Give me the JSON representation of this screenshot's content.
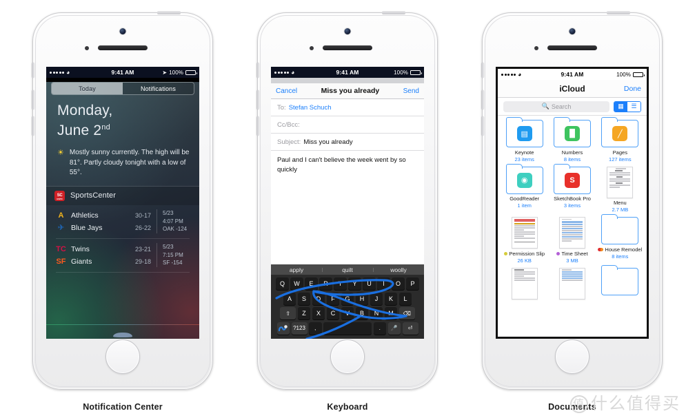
{
  "statusbar": {
    "time": "9:41 AM",
    "battery": "100%",
    "carrier_dots": 5,
    "wifi_icon": "wifi-icon",
    "location_icon": "location-arrow-icon"
  },
  "panel1": {
    "caption": "Notification Center",
    "segmented": {
      "today": "Today",
      "notifications": "Notifications",
      "selected": "Today"
    },
    "date_line1": "Monday,",
    "date_line2": "June 2",
    "date_ordinal": "nd",
    "weather_icon": "sun-icon",
    "weather_text": "Mostly sunny currently. The high will be 81°. Partly cloudy tonight with a low of 55°.",
    "widget_title": "SportsCenter",
    "widget_logo": "espn-sportscenter-icon",
    "games": [
      {
        "rows": [
          {
            "logo": "athletics-icon",
            "logo_glyph": "A",
            "logo_color": "#efb21e",
            "team": "Athletics",
            "record": "30-17"
          },
          {
            "logo": "blue-jays-icon",
            "logo_glyph": "⚑",
            "logo_color": "#134a8e",
            "team": "Blue Jays",
            "record": "26-22"
          }
        ],
        "date": "5/23",
        "time": "4:07 PM",
        "line": "OAK -124"
      },
      {
        "rows": [
          {
            "logo": "twins-icon",
            "logo_glyph": "TC",
            "logo_color": "#d31145",
            "team": "Twins",
            "record": "23-21"
          },
          {
            "logo": "giants-icon",
            "logo_glyph": "SF",
            "logo_color": "#fd5a1e",
            "team": "Giants",
            "record": "29-18"
          }
        ],
        "date": "5/23",
        "time": "7:15 PM",
        "line": "SF -154"
      }
    ],
    "grabber": "grabber-handle"
  },
  "panel2": {
    "caption": "Keyboard",
    "nav": {
      "cancel": "Cancel",
      "title": "Miss you already",
      "send": "Send"
    },
    "fields": [
      {
        "label": "To:",
        "value": "Stefan Schuch",
        "style": "blue"
      },
      {
        "label": "Cc/Bcc:",
        "value": "",
        "style": "blue"
      },
      {
        "label": "Subject:",
        "value": "Miss you already",
        "style": "dark"
      }
    ],
    "body": "Paul and I can't believe the week went by so quickly",
    "keyboard": {
      "suggestions": [
        "apply",
        "quilt",
        "woolly"
      ],
      "row1": [
        "Q",
        "W",
        "E",
        "R",
        "T",
        "Y",
        "U",
        "I",
        "O",
        "P"
      ],
      "row2": [
        "A",
        "S",
        "D",
        "F",
        "G",
        "H",
        "J",
        "K",
        "L"
      ],
      "row3_shift": "shift-icon",
      "row3": [
        "Z",
        "X",
        "C",
        "V",
        "B",
        "N",
        "M"
      ],
      "row3_backspace": "backspace-icon",
      "bottom": {
        "swype": "swype-trace-icon",
        "numbers": "?123",
        "comma": ",",
        "space": "",
        "period": ".",
        "mic": "microphone-icon",
        "enter": "return-icon"
      },
      "trace": "blue-swipe-trace"
    }
  },
  "panel3": {
    "caption": "Documents",
    "nav": {
      "title": "iCloud",
      "done": "Done"
    },
    "search_placeholder": "Search",
    "search_icon": "search-icon",
    "view_grid_icon": "grid-view-icon",
    "view_list_icon": "list-view-icon",
    "view_selected": "grid",
    "items": [
      {
        "type": "folder",
        "app": "keynote-icon",
        "icon_glyph": "▤",
        "icon_bg": "#1f9bf0",
        "name": "Keynote",
        "sub": "23 items",
        "tag": ""
      },
      {
        "type": "folder",
        "app": "numbers-icon",
        "icon_glyph": "█",
        "icon_bg": "#3ec45f",
        "name": "Numbers",
        "sub": "8 items",
        "tag": ""
      },
      {
        "type": "folder",
        "app": "pages-icon",
        "icon_glyph": "✎",
        "icon_bg": "#f5a623",
        "name": "Pages",
        "sub": "127 items",
        "tag": ""
      },
      {
        "type": "folder",
        "app": "goodreader-icon",
        "icon_glyph": "◉",
        "icon_bg": "#3ecfc0",
        "name": "GoodReader",
        "sub": "1 item",
        "tag": ""
      },
      {
        "type": "folder",
        "app": "sketchbook-icon",
        "icon_glyph": "S",
        "icon_bg": "#e8302a",
        "name": "SketchBook Pro",
        "sub": "3 items",
        "tag": ""
      },
      {
        "type": "doc",
        "variant": "menu",
        "name": "Menu",
        "sub": "2.7 MB",
        "tag": ""
      },
      {
        "type": "doc",
        "variant": "permission",
        "name": "Permission Slip",
        "sub": "26 KB",
        "tag": "#d6cc3a"
      },
      {
        "type": "doc",
        "variant": "timesheet",
        "name": "Time Sheet",
        "sub": "3 MB",
        "tag": "#b35fd6"
      },
      {
        "type": "folder",
        "app": "plain-folder-icon",
        "icon_glyph": "",
        "icon_bg": "",
        "name": "House Remodel",
        "sub": "8 items",
        "tag": "#f06a1e"
      },
      {
        "type": "doc",
        "variant": "text",
        "name": "",
        "sub": "",
        "tag": ""
      },
      {
        "type": "doc",
        "variant": "form",
        "name": "",
        "sub": "",
        "tag": ""
      },
      {
        "type": "folder",
        "app": "plain-folder-icon",
        "icon_glyph": "",
        "icon_bg": "",
        "name": "",
        "sub": "",
        "tag": ""
      }
    ]
  },
  "watermark": {
    "mark": "值",
    "text": "什么值得买"
  },
  "colors": {
    "ios_blue": "#1b7ffb",
    "keyboard_bg": "#2b2b2b",
    "swipe_trace": "#1a6fe0"
  }
}
